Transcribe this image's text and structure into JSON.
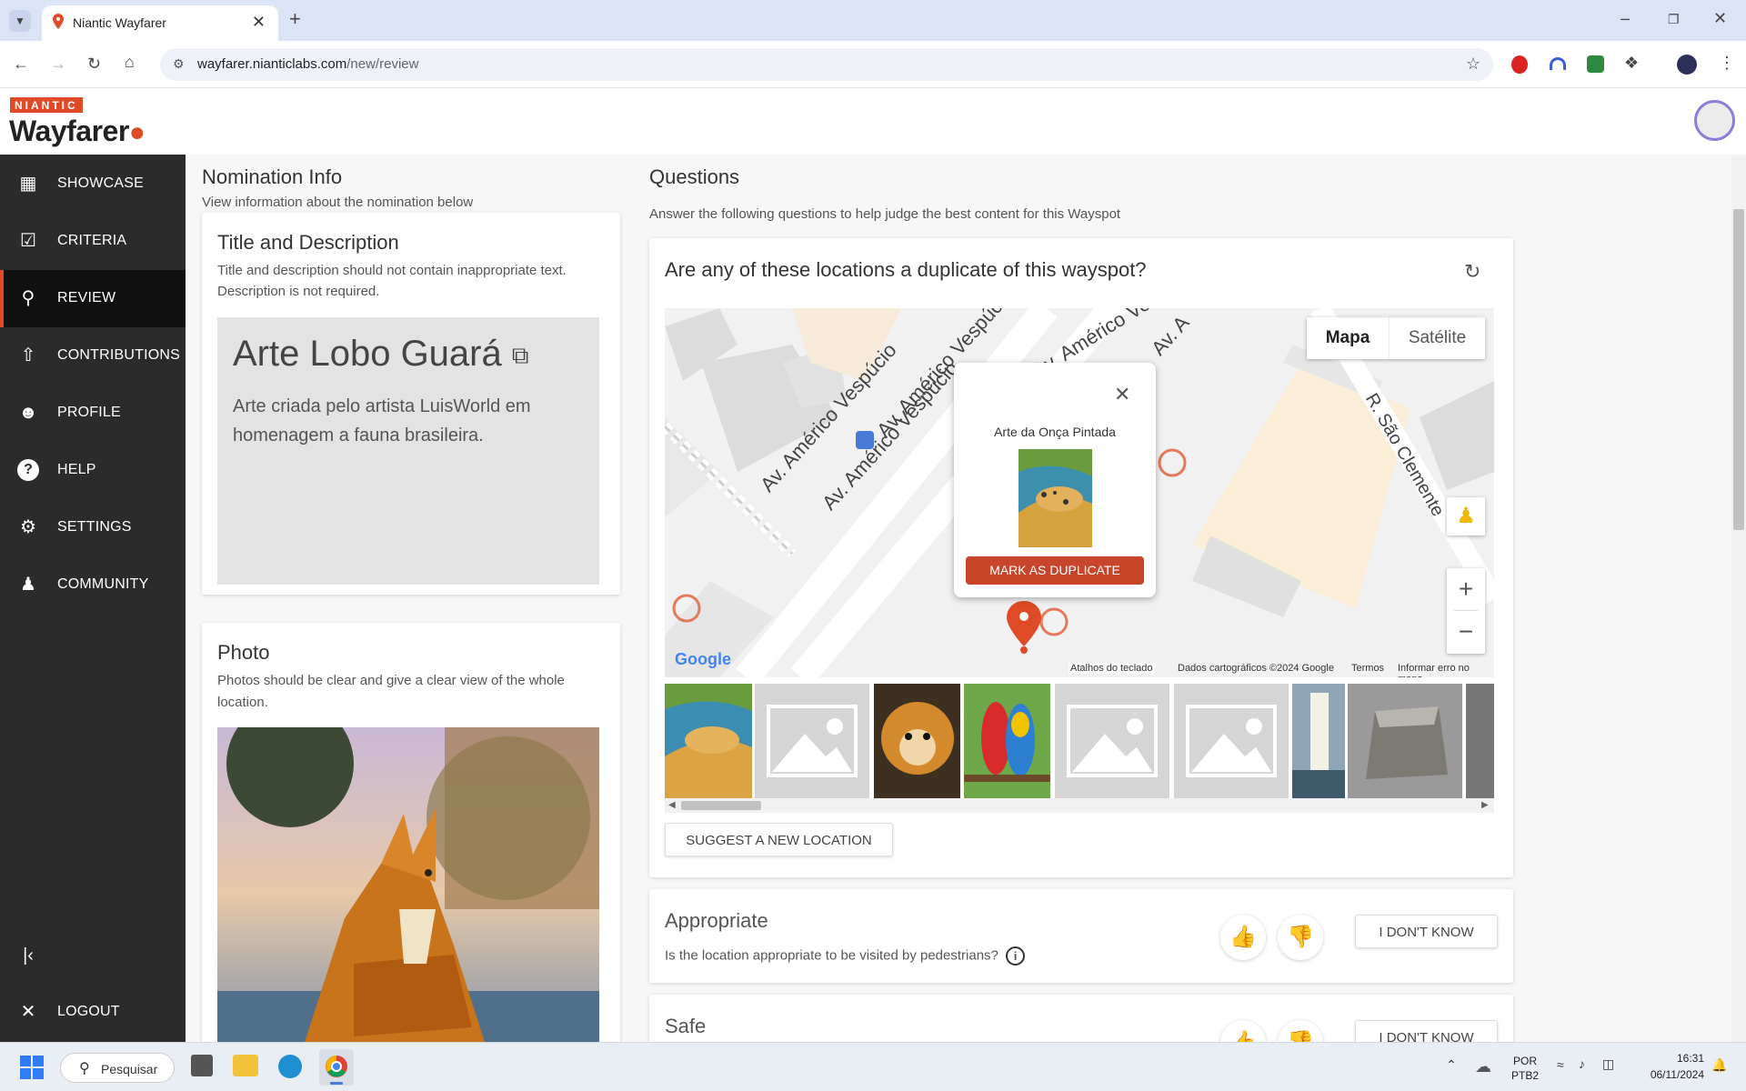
{
  "browser": {
    "tab_title": "Niantic Wayfarer",
    "url_host": "wayfarer.nianticlabs.com",
    "url_path": "/new/review"
  },
  "header": {
    "brand_top": "NIANTIC",
    "brand_main": "Wayfarer"
  },
  "sidebar": {
    "items": [
      {
        "label": "SHOWCASE",
        "icon": "showcase-icon"
      },
      {
        "label": "CRITERIA",
        "icon": "criteria-icon"
      },
      {
        "label": "REVIEW",
        "icon": "pin-icon"
      },
      {
        "label": "CONTRIBUTIONS",
        "icon": "contributions-icon"
      },
      {
        "label": "PROFILE",
        "icon": "person-icon"
      },
      {
        "label": "HELP",
        "icon": "help-icon"
      },
      {
        "label": "SETTINGS",
        "icon": "gear-icon"
      },
      {
        "label": "COMMUNITY",
        "icon": "community-icon"
      }
    ],
    "logout": "LOGOUT",
    "active": "REVIEW"
  },
  "nomination": {
    "section_title": "Nomination Info",
    "section_sub": "View information about the nomination below",
    "td_title": "Title and Description",
    "td_hint": "Title and description should not contain inappropriate text. Description is not required.",
    "name": "Arte Lobo Guará",
    "description": "Arte criada pelo artista LuisWorld em homenagem a fauna brasileira.",
    "photo_title": "Photo",
    "photo_hint": "Photos should be clear and give a clear view of the whole location."
  },
  "questions": {
    "title": "Questions",
    "sub": "Answer the following questions to help judge the best content for this Wayspot",
    "duplicate_q": "Are any of these locations a duplicate of this wayspot?",
    "map_type": [
      "Mapa",
      "Satélite"
    ],
    "popup_title": "Arte da Onça Pintada",
    "popup_button": "MARK AS DUPLICATE",
    "streets": [
      "Av. Américo Vespúcio",
      "Av. Américo Vespúcio",
      "Av. Américo Vespúcio",
      "Av. A",
      "Av. Américo Vespúcio",
      "R. São Clemente"
    ],
    "map_footer": [
      "Atalhos do teclado",
      "Dados cartográficos ©2024 Google",
      "Termos",
      "Informar erro no mapa"
    ],
    "google_logo": "Google",
    "suggest": "SUGGEST A NEW LOCATION",
    "appropriate_title": "Appropriate",
    "appropriate_q": "Is the location appropriate to be visited by pedestrians?",
    "dont_know": "I DON'T KNOW",
    "safe_title": "Safe"
  },
  "taskbar": {
    "search": "Pesquisar",
    "lang1": "POR",
    "lang2": "PTB2",
    "time": "16:31",
    "date": "06/11/2024"
  },
  "colors": {
    "accent": "#df4b26",
    "sidebar": "#2b2b2b"
  }
}
